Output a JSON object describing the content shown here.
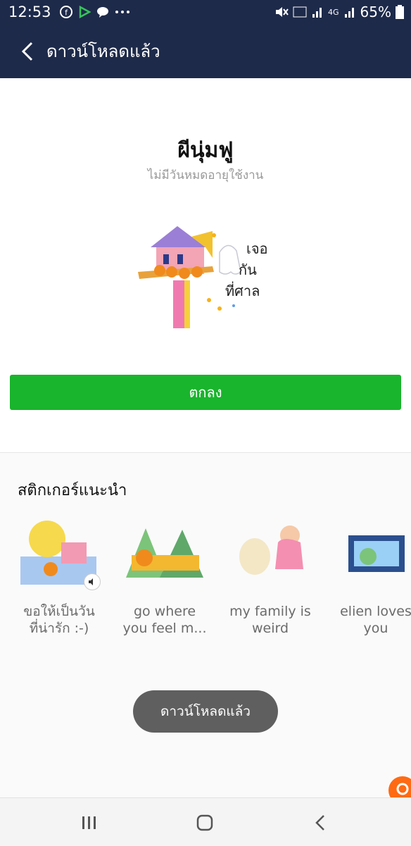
{
  "status_bar": {
    "time": "12:53",
    "battery": "65%",
    "network": "4G"
  },
  "appbar": {
    "title": "ดาวน์โหลดแล้ว"
  },
  "sticker": {
    "title": "ผีนุ่มฟู",
    "subtitle": "ไม่มีวันหมดอายุใช้งาน",
    "hero_text_1": "เจอ",
    "hero_text_2": "กัน",
    "hero_text_3": "ที่ศาล"
  },
  "ok_button": {
    "label": "ตกลง"
  },
  "recommended": {
    "title": "สติกเกอร์แนะนำ",
    "items": [
      {
        "name_line1": "ขอให้เป็นวัน",
        "name_line2": "ที่น่ารัก :-)",
        "has_sound": true
      },
      {
        "name_line1": "go where",
        "name_line2": "you feel m...",
        "has_sound": false
      },
      {
        "name_line1": "my family is",
        "name_line2": "weird",
        "has_sound": false
      },
      {
        "name_line1": "elien loves",
        "name_line2": "you",
        "has_sound": false
      }
    ]
  },
  "toast": {
    "text": "ดาวน์โหลดแล้ว"
  },
  "colors": {
    "header": "#1e2a4a",
    "ok_green": "#19b52c",
    "toast": "#5f5f5f",
    "badge_orange": "#ff6a13"
  }
}
